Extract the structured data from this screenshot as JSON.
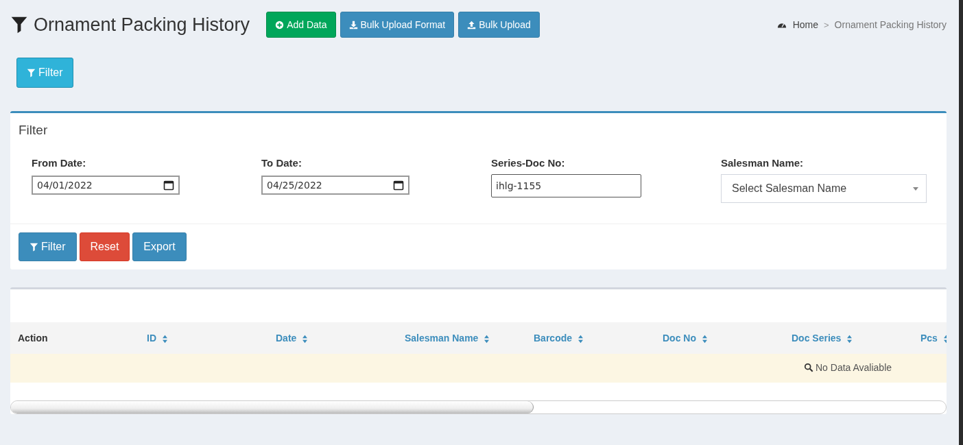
{
  "header": {
    "title": "Ornament Packing History",
    "buttons": [
      {
        "label": "Add Data",
        "kind": "add"
      },
      {
        "label": "Bulk Upload Format",
        "kind": "download"
      },
      {
        "label": "Bulk Upload",
        "kind": "upload"
      }
    ]
  },
  "breadcrumb": {
    "home": "Home",
    "separator": ">",
    "current": "Ornament Packing History"
  },
  "toggle_button": {
    "label": "Filter"
  },
  "filter_panel": {
    "title": "Filter",
    "fields": [
      {
        "kind": "date",
        "label": "From Date:",
        "value": "04/01/2022"
      },
      {
        "kind": "date",
        "label": "To Date:",
        "value": "04/25/2022"
      },
      {
        "kind": "text",
        "label": "Series-Doc No:",
        "value": "ihlg-1155"
      },
      {
        "kind": "select",
        "label": "Salesman Name:",
        "placeholder": "Select Salesman Name"
      }
    ],
    "buttons": [
      {
        "label": "Filter",
        "kind": "filter"
      },
      {
        "label": "Reset",
        "kind": "reset"
      },
      {
        "label": "Export",
        "kind": "export"
      }
    ]
  },
  "table": {
    "columns": [
      {
        "label": "Action",
        "sortable": false
      },
      {
        "label": "ID",
        "sortable": true
      },
      {
        "label": "Date",
        "sortable": true
      },
      {
        "label": "Salesman Name",
        "sortable": true
      },
      {
        "label": "Barcode",
        "sortable": true
      },
      {
        "label": "Doc No",
        "sortable": true
      },
      {
        "label": "Doc Series",
        "sortable": true
      },
      {
        "label": "Pcs",
        "sortable": true
      }
    ],
    "empty_message": "No Data Avaliable"
  }
}
